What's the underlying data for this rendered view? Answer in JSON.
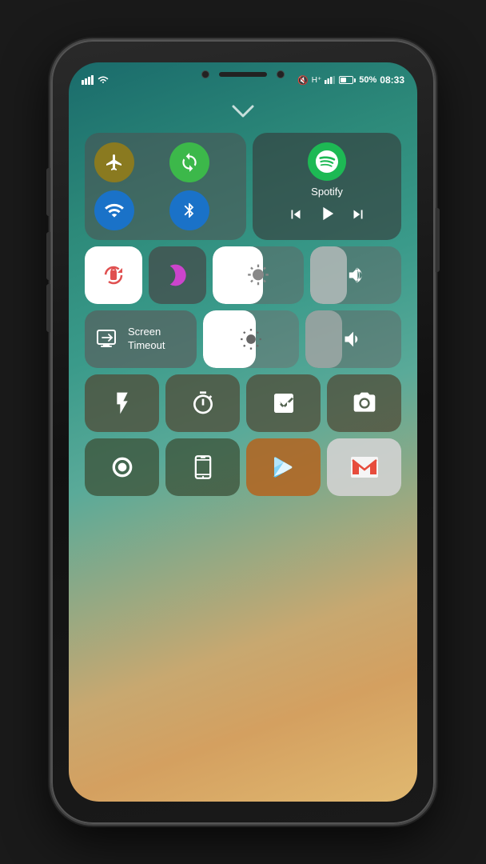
{
  "phone": {
    "status_bar": {
      "left_icons": [
        "signal-icon",
        "wifi-status-icon"
      ],
      "mute_icon": "🔕",
      "signal_bars": "50%",
      "time": "08:33"
    },
    "chevron": "❯",
    "spotify": {
      "label": "Spotify",
      "play_icon": "▶",
      "prev_icon": "⏮",
      "next_icon": "⏭"
    },
    "toggles": {
      "airplane": "✈",
      "sync": "↺",
      "wifi": "wifi",
      "bluetooth": "bluetooth"
    },
    "tiles": {
      "lock_rotation": "🔒",
      "do_not_disturb": "moon",
      "screen_timeout": "Screen\nTimeout",
      "screen_timeout_icon": "screen"
    },
    "apps_row1": [
      {
        "name": "flashlight",
        "icon": "🔦"
      },
      {
        "name": "timer",
        "icon": "⏱"
      },
      {
        "name": "calculator",
        "icon": "🧮"
      },
      {
        "name": "camera",
        "icon": "📷"
      }
    ],
    "apps_row2": [
      {
        "name": "screen-record",
        "icon": "⏺"
      },
      {
        "name": "phone-mirror",
        "icon": "📱"
      },
      {
        "name": "play-store",
        "icon": "▶"
      },
      {
        "name": "gmail",
        "icon": "M"
      }
    ]
  }
}
